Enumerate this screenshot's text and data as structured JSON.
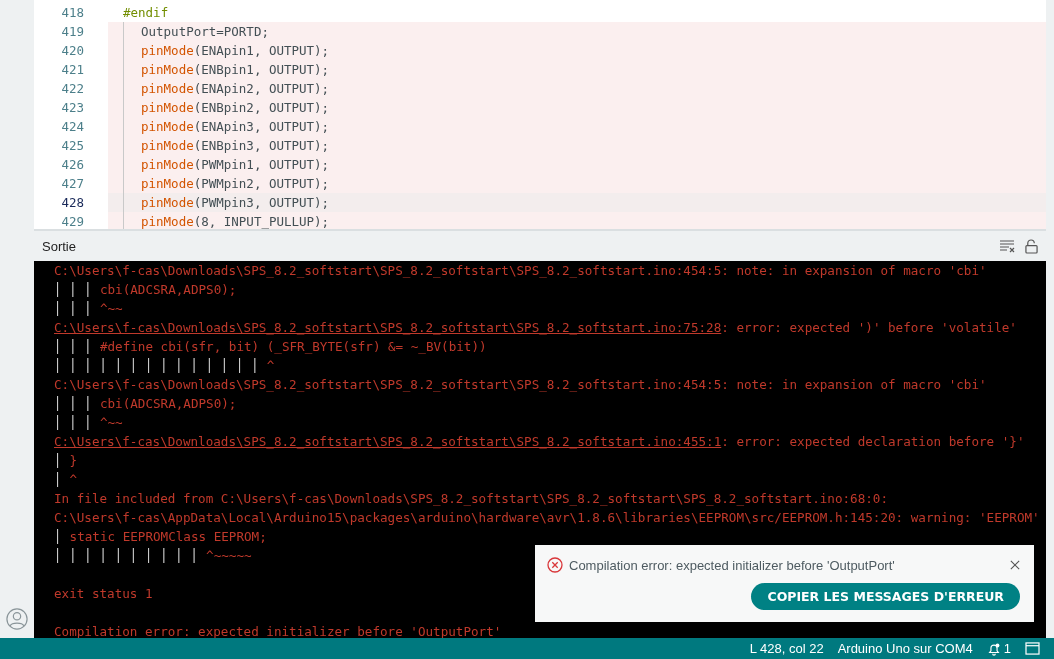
{
  "editor": {
    "lines": [
      {
        "number": "418",
        "current": false,
        "error": false,
        "indent": false,
        "tokens": [
          {
            "kind": "directive",
            "text": "#endif"
          }
        ]
      },
      {
        "number": "419",
        "current": false,
        "error": true,
        "indent": true,
        "tokens": [
          {
            "kind": "plain",
            "text": "OutputPort=PORTD;"
          }
        ]
      },
      {
        "number": "420",
        "current": false,
        "error": true,
        "indent": true,
        "tokens": [
          {
            "kind": "function",
            "text": "pinMode"
          },
          {
            "kind": "plain",
            "text": "(ENApin1, OUTPUT);"
          }
        ]
      },
      {
        "number": "421",
        "current": false,
        "error": true,
        "indent": true,
        "tokens": [
          {
            "kind": "function",
            "text": "pinMode"
          },
          {
            "kind": "plain",
            "text": "(ENBpin1, OUTPUT);"
          }
        ]
      },
      {
        "number": "422",
        "current": false,
        "error": true,
        "indent": true,
        "tokens": [
          {
            "kind": "function",
            "text": "pinMode"
          },
          {
            "kind": "plain",
            "text": "(ENApin2, OUTPUT);"
          }
        ]
      },
      {
        "number": "423",
        "current": false,
        "error": true,
        "indent": true,
        "tokens": [
          {
            "kind": "function",
            "text": "pinMode"
          },
          {
            "kind": "plain",
            "text": "(ENBpin2, OUTPUT);"
          }
        ]
      },
      {
        "number": "424",
        "current": false,
        "error": true,
        "indent": true,
        "tokens": [
          {
            "kind": "function",
            "text": "pinMode"
          },
          {
            "kind": "plain",
            "text": "(ENApin3, OUTPUT);"
          }
        ]
      },
      {
        "number": "425",
        "current": false,
        "error": true,
        "indent": true,
        "tokens": [
          {
            "kind": "function",
            "text": "pinMode"
          },
          {
            "kind": "plain",
            "text": "(ENBpin3, OUTPUT);"
          }
        ]
      },
      {
        "number": "426",
        "current": false,
        "error": true,
        "indent": true,
        "tokens": [
          {
            "kind": "function",
            "text": "pinMode"
          },
          {
            "kind": "plain",
            "text": "(PWMpin1, OUTPUT);"
          }
        ]
      },
      {
        "number": "427",
        "current": false,
        "error": true,
        "indent": true,
        "tokens": [
          {
            "kind": "function",
            "text": "pinMode"
          },
          {
            "kind": "plain",
            "text": "(PWMpin2, OUTPUT);"
          }
        ]
      },
      {
        "number": "428",
        "current": true,
        "error": true,
        "indent": true,
        "tokens": [
          {
            "kind": "function",
            "text": "pinMode"
          },
          {
            "kind": "plain",
            "text": "(PWMpin3, OUTPUT);"
          }
        ]
      },
      {
        "number": "429",
        "current": false,
        "error": true,
        "indent": true,
        "tokens": [
          {
            "kind": "function",
            "text": "pinMode"
          },
          {
            "kind": "plain",
            "text": "(8, INPUT_PULLUP);"
          }
        ]
      }
    ]
  },
  "output": {
    "title": "Sortie",
    "lines": [
      {
        "kind": "text",
        "text": "C:\\Users\\f-cas\\Downloads\\SPS_8.2_softstart\\SPS_8.2_softstart\\SPS_8.2_softstart.ino:454:5: note: in expansion of macro 'cbi'"
      },
      {
        "kind": "guide",
        "gutter": "│ │ │",
        "text": "cbi(ADCSRA,ADPS0);"
      },
      {
        "kind": "guide",
        "gutter": "│ │ │",
        "text": "^~~"
      },
      {
        "kind": "link",
        "link": "C:\\Users\\f-cas\\Downloads\\SPS_8.2_softstart\\SPS_8.2_softstart\\SPS_8.2_softstart.ino:75:28",
        "text": ": error: expected ')' before 'volatile'"
      },
      {
        "kind": "guide",
        "gutter": "│ │ │",
        "text": "#define cbi(sfr, bit) (_SFR_BYTE(sfr) &= ~_BV(bit))"
      },
      {
        "kind": "guide",
        "gutter": "│ │ │ │ │ │ │ │ │ │ │ │ │ │",
        "text": "^"
      },
      {
        "kind": "text",
        "text": "C:\\Users\\f-cas\\Downloads\\SPS_8.2_softstart\\SPS_8.2_softstart\\SPS_8.2_softstart.ino:454:5: note: in expansion of macro 'cbi'"
      },
      {
        "kind": "guide",
        "gutter": "│ │ │",
        "text": "cbi(ADCSRA,ADPS0);"
      },
      {
        "kind": "guide",
        "gutter": "│ │ │",
        "text": "^~~"
      },
      {
        "kind": "link",
        "link": "C:\\Users\\f-cas\\Downloads\\SPS_8.2_softstart\\SPS_8.2_softstart\\SPS_8.2_softstart.ino:455:1",
        "text": ": error: expected declaration before '}'"
      },
      {
        "kind": "guide",
        "gutter": "│",
        "text": "}"
      },
      {
        "kind": "guide",
        "gutter": "│",
        "text": "^"
      },
      {
        "kind": "text",
        "text": "In file included from C:\\Users\\f-cas\\Downloads\\SPS_8.2_softstart\\SPS_8.2_softstart\\SPS_8.2_softstart.ino:68:0:"
      },
      {
        "kind": "text",
        "text": "C:\\Users\\f-cas\\AppData\\Local\\Arduino15\\packages\\arduino\\hardware\\avr\\1.8.6\\libraries\\EEPROM\\src/EEPROM.h:145:20: warning: 'EEPROM'"
      },
      {
        "kind": "guide",
        "gutter": "│",
        "text": "static EEPROMClass EEPROM;"
      },
      {
        "kind": "guide",
        "gutter": "│ │ │ │ │ │ │ │ │ │",
        "text": "^~~~~~"
      },
      {
        "kind": "blank"
      },
      {
        "kind": "text",
        "text": "exit status 1"
      },
      {
        "kind": "blank"
      },
      {
        "kind": "text",
        "text": "Compilation error: expected initializer before 'OutputPort'"
      }
    ]
  },
  "toast": {
    "message": "Compilation error: expected initializer before 'OutputPort'",
    "button": "COPIER LES MESSAGES D'ERREUR"
  },
  "status_bar": {
    "position": "L 428, col 22",
    "board": "Arduino Uno sur COM4",
    "notifications": "1"
  }
}
